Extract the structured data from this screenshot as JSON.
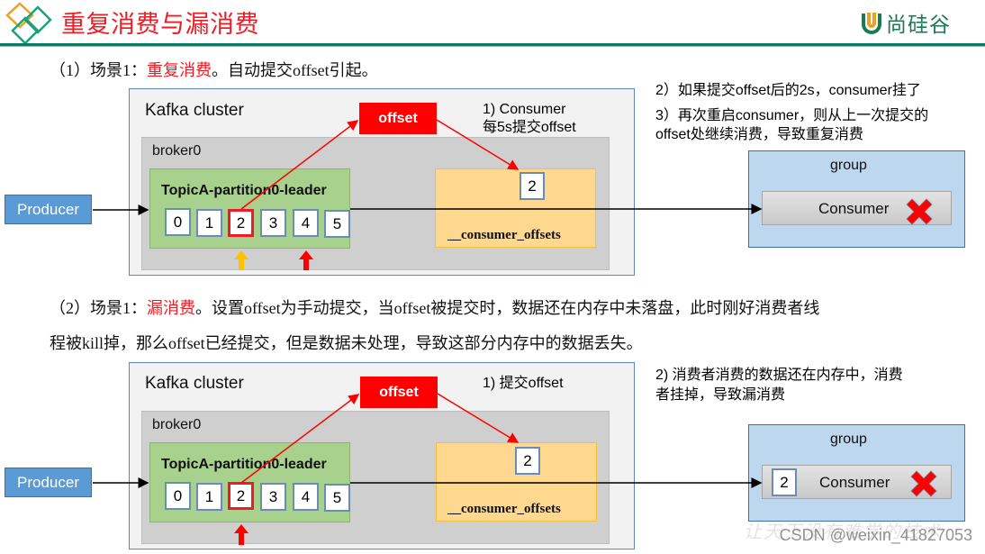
{
  "header": {
    "title": "重复消费与漏消费",
    "brand": "尚硅谷",
    "logo_icon": "diamond-logo-icon",
    "brand_icon": "u-logo-icon"
  },
  "colors": {
    "accent_red": "#ee1c25",
    "header_green": "#0f7a5b",
    "producer_blue": "#5b9bd5",
    "partition_green": "#a9d18e",
    "offsets_yellow": "#ffd88f",
    "group_blue": "#bdd7ee"
  },
  "scenario1": {
    "prefix": "（1）场景1：",
    "highlight": "重复消费",
    "suffix": "。自动提交offset引起。",
    "diagram": {
      "cluster_label": "Kafka cluster",
      "broker_label": "broker0",
      "partition_label": "TopicA-partition0-leader",
      "cells": [
        "0",
        "1",
        "2",
        "3",
        "4",
        "5"
      ],
      "selected_cell": "2",
      "offset_tag": "offset",
      "note_line1": "1)   Consumer",
      "note_line2": "每5s提交offset",
      "offsets_value": "2",
      "offsets_label": "__consumer_offsets",
      "producer": "Producer",
      "group_label": "group",
      "consumer_label": "Consumer",
      "consumer_status_icon": "red-x-icon"
    },
    "side_notes": [
      "2）如果提交offset后的2s，consumer挂了",
      "3）再次重启consumer，则从上一次提交的",
      "offset处继续消费，导致重复消费"
    ]
  },
  "scenario2": {
    "prefix": "（2）场景1：",
    "highlight": "漏消费",
    "suffix": "。设置offset为手动提交，当offset被提交时，数据还在内存中未落盘，此时刚好消费者线",
    "line2": "程被kill掉，那么offset已经提交，但是数据未处理，导致这部分内存中的数据丢失。",
    "diagram": {
      "cluster_label": "Kafka cluster",
      "broker_label": "broker0",
      "partition_label": "TopicA-partition0-leader",
      "cells": [
        "0",
        "1",
        "2",
        "3",
        "4",
        "5"
      ],
      "selected_cell": "2",
      "offset_tag": "offset",
      "note_line1": "1)   提交offset",
      "offsets_value": "2",
      "offsets_label": "__consumer_offsets",
      "producer": "Producer",
      "group_label": "group",
      "consumer_memory_value": "2",
      "consumer_label": "Consumer",
      "consumer_status_icon": "red-x-icon"
    },
    "side_notes": [
      "2)  消费者消费的数据还在内存中，消费",
      "者挂掉，导致漏消费"
    ]
  },
  "watermark": {
    "text": "CSDN @weixin_41827053",
    "faint_text": "让天下没有难学的技术"
  }
}
